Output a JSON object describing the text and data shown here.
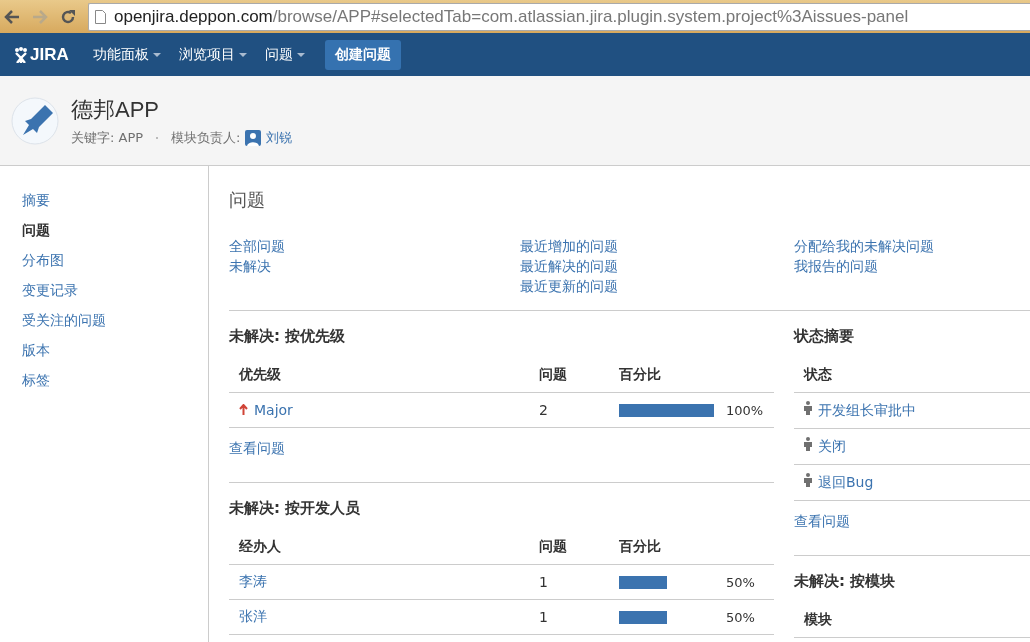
{
  "browser": {
    "url_host": "openjira.deppon.com",
    "url_path": "/browse/APP#selectedTab=com.atlassian.jira.plugin.system.project%3Aissues-panel"
  },
  "nav": {
    "logo": "JIRA",
    "menus": [
      "功能面板",
      "浏览项目",
      "问题"
    ],
    "create_button": "创建问题"
  },
  "project": {
    "name": "德邦APP",
    "key_label": "关键字:",
    "key": "APP",
    "lead_label": "模块负责人:",
    "lead": "刘锐"
  },
  "sidebar": {
    "items": [
      {
        "label": "摘要",
        "selected": false
      },
      {
        "label": "问题",
        "selected": true
      },
      {
        "label": "分布图",
        "selected": false
      },
      {
        "label": "变更记录",
        "selected": false
      },
      {
        "label": "受关注的问题",
        "selected": false
      },
      {
        "label": "版本",
        "selected": false
      },
      {
        "label": "标签",
        "selected": false
      }
    ]
  },
  "content": {
    "title": "问题",
    "filter_columns": [
      [
        "全部问题",
        "未解决"
      ],
      [
        "最近增加的问题",
        "最近解决的问题",
        "最近更新的问题"
      ],
      [
        "分配给我的未解决问题",
        "我报告的问题"
      ]
    ],
    "left_sections": [
      {
        "title": "未解决: 按优先级",
        "columns": [
          "优先级",
          "问题",
          "百分比"
        ],
        "rows": [
          {
            "name": "Major",
            "kind": "priority",
            "count": "2",
            "level": 1.0,
            "percent": "100%"
          }
        ],
        "link": "查看问题"
      },
      {
        "title": "未解决: 按开发人员",
        "columns": [
          "经办人",
          "问题",
          "百分比"
        ],
        "rows": [
          {
            "name": "李涛",
            "kind": "person",
            "count": "1",
            "level": 0.5,
            "percent": "50%"
          },
          {
            "name": "张洋",
            "kind": "person",
            "count": "1",
            "level": 0.5,
            "percent": "50%"
          }
        ]
      }
    ],
    "status_summary": {
      "title": "状态摘要",
      "column": "状态",
      "rows": [
        "开发组长审批中",
        "关闭",
        "退回Bug"
      ],
      "link": "查看问题"
    },
    "by_component": {
      "title": "未解决: 按模块",
      "column": "模块"
    }
  }
}
